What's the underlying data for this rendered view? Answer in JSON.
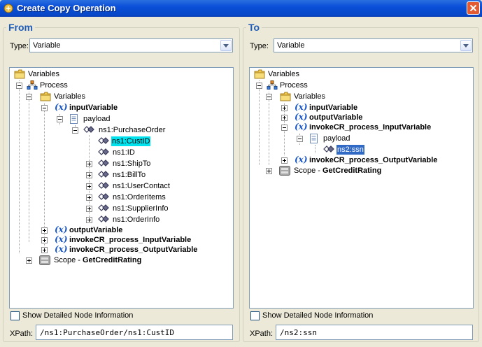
{
  "window": {
    "title": "Create Copy Operation",
    "close_icon": "close-icon"
  },
  "from": {
    "legend": "From",
    "type_label": "Type:",
    "type_value": "Variable",
    "tree": {
      "root": "Variables",
      "process": "Process",
      "variables": "Variables",
      "input_variable": "inputVariable",
      "payload": "payload",
      "purchase_order": "ns1:PurchaseOrder",
      "cust_id": "ns1:CustID",
      "id": "ns1:ID",
      "ship_to": "ns1:ShipTo",
      "bill_to": "ns1:BillTo",
      "user_contact": "ns1:UserContact",
      "order_items": "ns1:OrderItems",
      "supplier_info": "ns1:SupplierInfo",
      "order_info": "ns1:OrderInfo",
      "output_variable": "outputVariable",
      "invoke_input": "invokeCR_process_InputVariable",
      "invoke_output": "invokeCR_process_OutputVariable",
      "scope_prefix": "Scope - ",
      "scope_name": "GetCreditRating"
    },
    "show_detail": "Show Detailed Node Information",
    "xpath_label": "XPath:",
    "xpath_value": "/ns1:PurchaseOrder/ns1:CustID"
  },
  "to": {
    "legend": "To",
    "type_label": "Type:",
    "type_value": "Variable",
    "tree": {
      "root": "Variables",
      "process": "Process",
      "variables": "Variables",
      "input_variable": "inputVariable",
      "output_variable": "outputVariable",
      "invoke_input": "invokeCR_process_InputVariable",
      "payload": "payload",
      "ssn": "ns2:ssn",
      "invoke_output": "invokeCR_process_OutputVariable",
      "scope_prefix": "Scope - ",
      "scope_name": "GetCreditRating"
    },
    "show_detail": "Show Detailed Node Information",
    "xpath_label": "XPath:",
    "xpath_value": "/ns2:ssn"
  },
  "var_marker": "(x)",
  "colors": {
    "legend": "#1e5cb8",
    "selection_from": "#00e3ef",
    "selection_to": "#316ac5",
    "title_bar": "#0a4fd8"
  }
}
